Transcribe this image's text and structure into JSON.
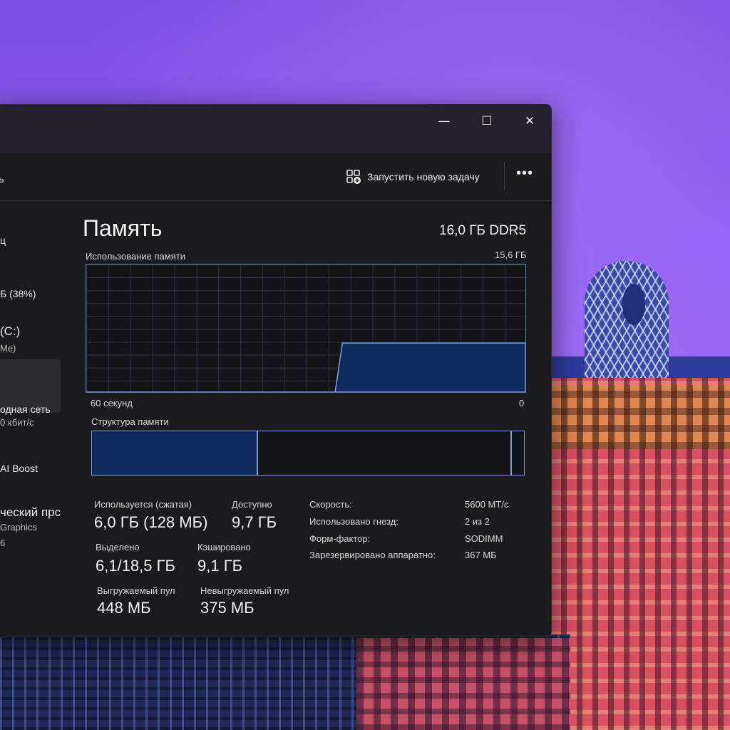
{
  "window": {
    "controls": {
      "minimize": "—",
      "maximize": "☐",
      "close": "✕"
    },
    "command_bar": {
      "run_new_task": "Запустить новую задачу",
      "more": "•••"
    },
    "header_partial": "ть"
  },
  "sidebar": {
    "items": [
      {
        "label": "ц"
      },
      {
        "label": "Б (38%)"
      },
      {
        "label": "(C:)",
        "sub": "Me)"
      },
      {
        "label": "одная сеть",
        "sub": "0 кбит/с"
      },
      {
        "label": "AI Boost"
      },
      {
        "label": "ческий прс",
        "sub": "Graphics",
        "sub2": "6"
      }
    ]
  },
  "memory": {
    "title": "Память",
    "capacity": "16,0 ГБ DDR5",
    "usage_label": "Использование памяти",
    "usage_max": "15,6 ГБ",
    "axis_left": "60 секунд",
    "axis_right": "0",
    "composition_label": "Структура памяти",
    "stats": {
      "in_use_label": "Используется (сжатая)",
      "in_use_value": "6,0 ГБ (128 МБ)",
      "available_label": "Доступно",
      "available_value": "9,7 ГБ",
      "committed_label": "Выделено",
      "committed_value": "6,1/18,5 ГБ",
      "cached_label": "Кэшировано",
      "cached_value": "9,1 ГБ",
      "paged_label": "Выгружаемый пул",
      "paged_value": "448 МБ",
      "nonpaged_label": "Невыгружаемый пул",
      "nonpaged_value": "375 МБ"
    },
    "details": [
      {
        "label": "Скорость:",
        "value": "5600 МТ/с"
      },
      {
        "label": "Использовано гнезд:",
        "value": "2 из 2"
      },
      {
        "label": "Форм-фактор:",
        "value": "SODIMM"
      },
      {
        "label": "Зарезервировано аппаратно:",
        "value": "367 МБ"
      }
    ]
  },
  "chart_data": {
    "type": "area",
    "title": "Использование памяти",
    "xlabel": "",
    "ylabel": "",
    "x_range_seconds": [
      60,
      0
    ],
    "y_max": 15.6,
    "series": [
      {
        "x": [
          60,
          26,
          25,
          0
        ],
        "y": [
          0,
          0,
          6.0,
          6.0
        ]
      }
    ]
  },
  "colors": {
    "accent": "#7ea0d6",
    "fill": "#0f2a5c",
    "window_bg": "#1b1b1e"
  }
}
